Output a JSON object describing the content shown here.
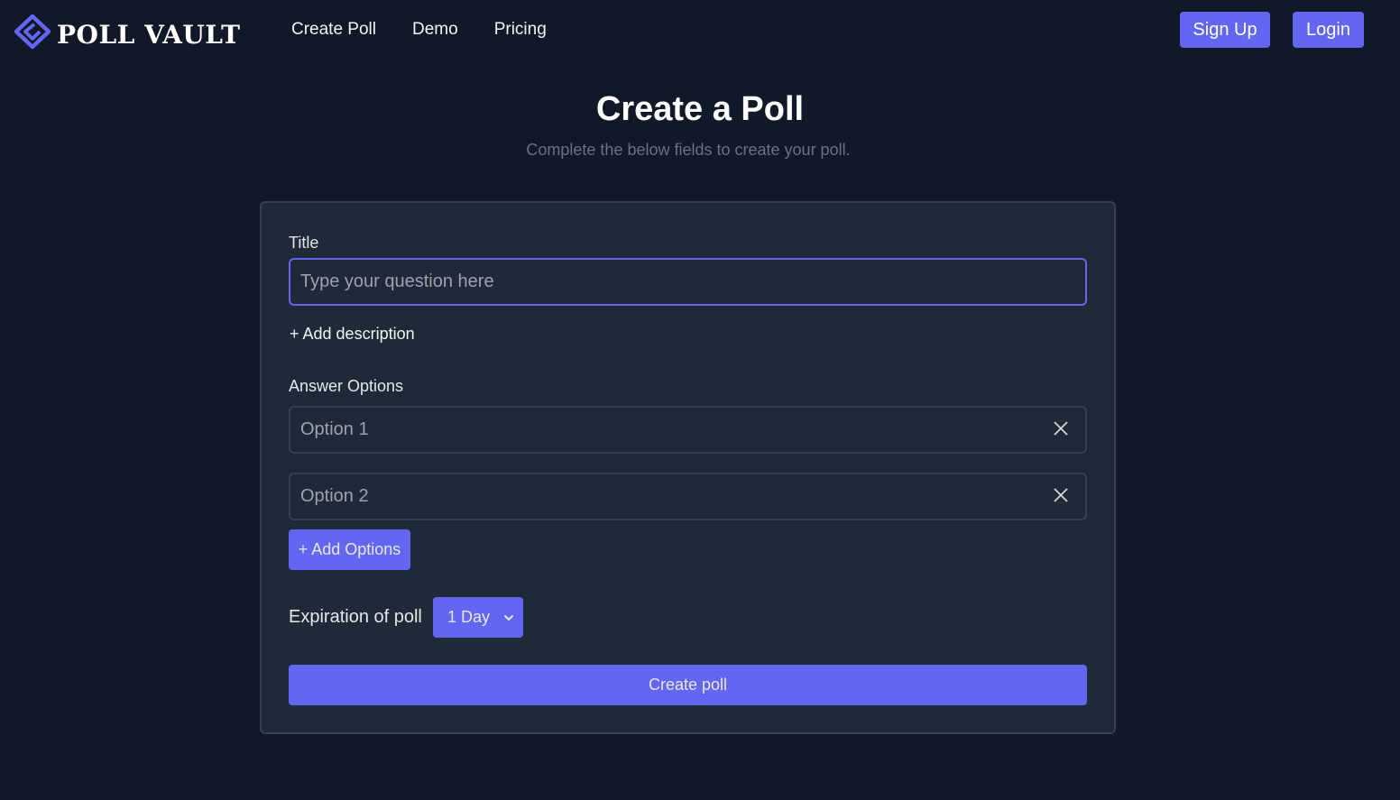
{
  "brand": {
    "name": "POLL VAULT",
    "logo_icon": "diamond-logo-icon",
    "accent_color": "#6366f1"
  },
  "nav": {
    "links": [
      "Create Poll",
      "Demo",
      "Pricing"
    ],
    "signup_label": "Sign Up",
    "login_label": "Login"
  },
  "page": {
    "title": "Create a Poll",
    "subtitle": "Complete the below fields to create your poll."
  },
  "form": {
    "title_label": "Title",
    "title_placeholder": "Type your question here",
    "title_value": "",
    "add_description_label": "+ Add description",
    "answer_options_label": "Answer Options",
    "options": [
      {
        "placeholder": "Option 1",
        "value": "",
        "remove_icon": "close-icon"
      },
      {
        "placeholder": "Option 2",
        "value": "",
        "remove_icon": "close-icon"
      }
    ],
    "add_options_label": "+ Add Options",
    "expiration_label": "Expiration of poll",
    "expiration_value": "1 Day",
    "submit_label": "Create poll"
  },
  "colors": {
    "background": "#111827",
    "card": "#1f2937",
    "border": "#374151",
    "muted_text": "#6b7280"
  }
}
